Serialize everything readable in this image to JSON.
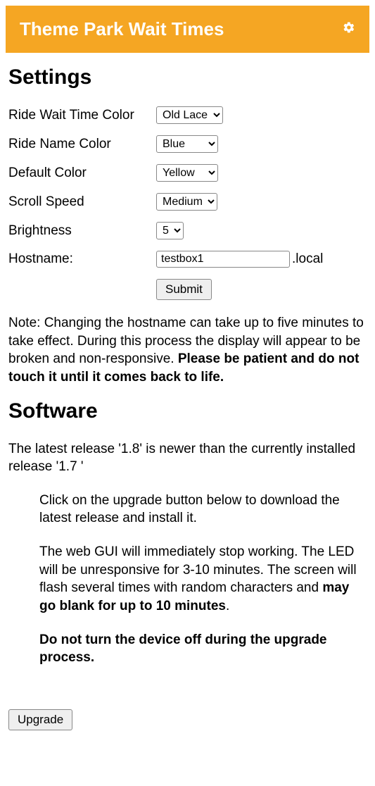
{
  "header": {
    "title": "Theme Park Wait Times"
  },
  "settings": {
    "heading": "Settings",
    "rows": {
      "ride_wait_time_color": {
        "label": "Ride Wait Time Color",
        "value": "Old Lace"
      },
      "ride_name_color": {
        "label": "Ride Name Color",
        "value": "Blue"
      },
      "default_color": {
        "label": "Default Color",
        "value": "Yellow"
      },
      "scroll_speed": {
        "label": "Scroll Speed",
        "value": "Medium"
      },
      "brightness": {
        "label": "Brightness",
        "value": "5"
      },
      "hostname": {
        "label": "Hostname:",
        "value": "testbox1",
        "suffix": ".local"
      }
    },
    "submit_label": "Submit",
    "note_plain": "Note: Changing the hostname can take up to five minutes to take effect. During this process the display will appear to be broken and non-responsive. ",
    "note_bold": "Please be patient and do not touch it until it comes back to life."
  },
  "software": {
    "heading": "Software",
    "status": "The latest release '1.8' is newer than the currently installed release '1.7 '",
    "p1": "Click on the upgrade button below to download the latest release and install it.",
    "p2_a": "The web GUI will immediately stop working. The LED will be unresponsive for 3-10 minutes. The screen will flash several times with random characters and ",
    "p2_b": "may go blank for up to 10 minutes",
    "p2_c": ".",
    "p3": "Do not turn the device off during the upgrade process.",
    "upgrade_label": "Upgrade"
  }
}
